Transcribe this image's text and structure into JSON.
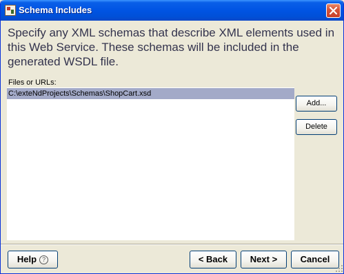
{
  "window": {
    "title": "Schema Includes"
  },
  "instruction": "Specify any XML schemas that describe XML elements used in this Web Service.  These schemas will be included in the generated WSDL file.",
  "files": {
    "label": "Files or URLs:",
    "items": [
      "C:\\exteNdProjects\\Schemas\\ShopCart.xsd"
    ]
  },
  "side_buttons": {
    "add": "Add...",
    "delete": "Delete"
  },
  "footer": {
    "help": "Help",
    "help_glyph": "?",
    "back": "< Back",
    "next": "Next >",
    "cancel": "Cancel"
  },
  "icons": {
    "app": "schema-app-icon",
    "close": "close-icon",
    "help": "help-circle-icon"
  },
  "colors": {
    "titlebar": "#0054e3",
    "selection": "#a3aac8",
    "instruction_text": "#33334d"
  }
}
